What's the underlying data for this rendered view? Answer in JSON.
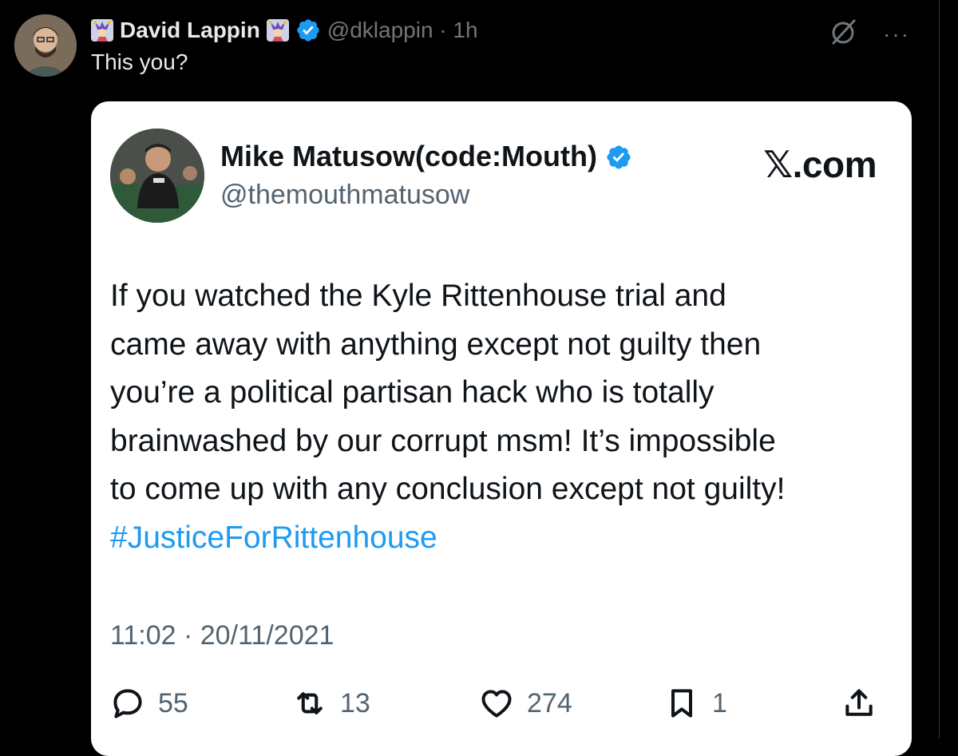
{
  "outer_tweet": {
    "author_name": "David Lappin",
    "handle_time": "@dklappin · 1h",
    "text": "This you?",
    "more_label": "···"
  },
  "quoted_card": {
    "author_name": "Mike Matusow(code:Mouth)",
    "handle": "@themouthmatusow",
    "brand": "𝕏.com",
    "body_lines": [
      "If you watched the Kyle Rittenhouse trial and",
      "came away with anything except not guilty then",
      "you’re a political partisan hack who is totally",
      "brainwashed by our corrupt msm! It’s impossible",
      "to come up with any conclusion except not guilty!"
    ],
    "hashtag": "#JusticeForRittenhouse",
    "timestamp": "11:02 · 20/11/2021",
    "stats": {
      "replies": "55",
      "reposts": "13",
      "likes": "274",
      "bookmarks": "1"
    }
  },
  "colors": {
    "background": "#000000",
    "card": "#ffffff",
    "verified": "#1d9bf0",
    "hashtag": "#1d9bf0",
    "muted": "#536471"
  }
}
